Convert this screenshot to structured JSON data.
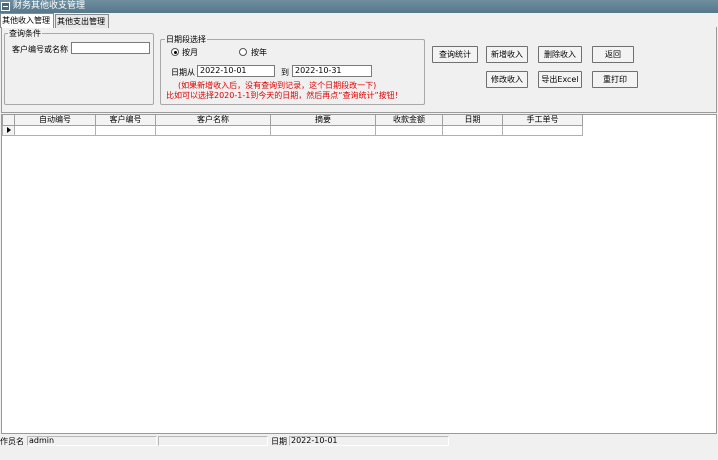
{
  "window": {
    "title": "财务其他收支管理"
  },
  "tabs": [
    {
      "label": "其他收入管理",
      "active": true
    },
    {
      "label": "其他支出管理",
      "active": false
    }
  ],
  "query": {
    "legend": "查询条件",
    "customer_label": "客户编号或名称",
    "customer_value": ""
  },
  "date_range": {
    "legend": "日期段选择",
    "by_month_label": "按月",
    "by_year_label": "按年",
    "selected": "按月",
    "from_label": "日期从",
    "from_value": "2022-10-01",
    "to_label": "到",
    "to_value": "2022-10-31",
    "hint_line1": "(如果新增收入后，没有查询到记录，这个日期段改一下)",
    "hint_line2": "比如可以选择2020-1-1到今天的日期，然后再点“查询统计”按钮！"
  },
  "buttons": {
    "query_stats": "查询统计",
    "add_income": "新增收入",
    "delete_income": "删除收入",
    "back": "返回",
    "edit_income": "修改收入",
    "export_excel": "导出Excel",
    "reprint": "重打印"
  },
  "grid": {
    "columns": [
      "自动编号",
      "客户编号",
      "客户名称",
      "摘要",
      "收款金额",
      "日期",
      "手工单号"
    ],
    "rows": [
      [
        "",
        "",
        "",
        "",
        "",
        "",
        ""
      ]
    ]
  },
  "status": {
    "operator_label": "作员名",
    "operator_value": "admin",
    "date_label": "日期",
    "date_value": "2022-10-01"
  },
  "colors": {
    "hint": "#e00000",
    "titlebar": "#5f8294"
  }
}
